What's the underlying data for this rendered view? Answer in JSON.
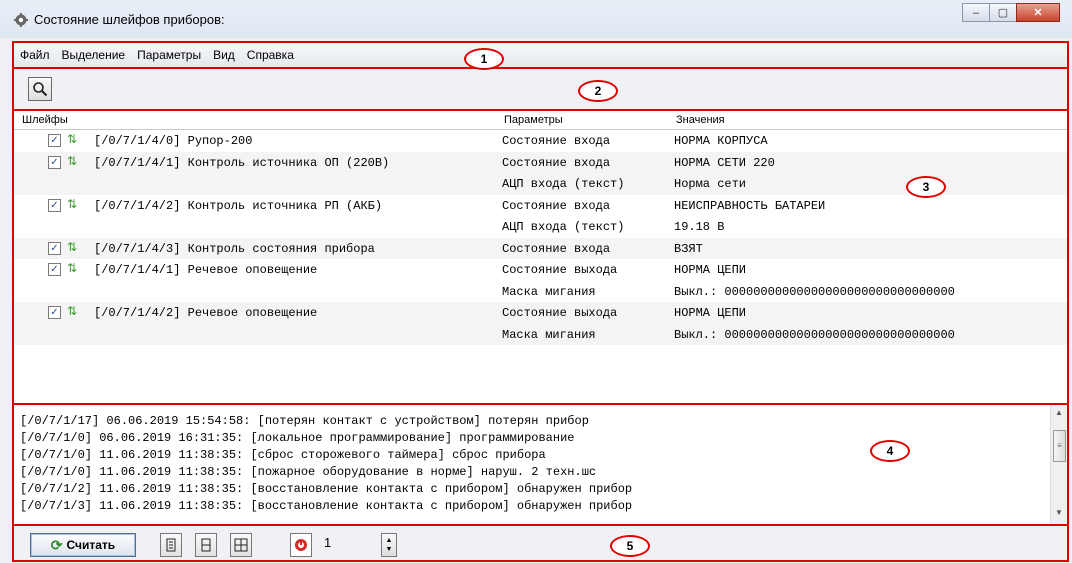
{
  "window": {
    "title": "Состояние шлейфов приборов:",
    "minimize": "–",
    "maximize": "▢",
    "close": "✕"
  },
  "menu": [
    "Файл",
    "Выделение",
    "Параметры",
    "Вид",
    "Справка"
  ],
  "toolbar": {
    "search_icon": "search-icon"
  },
  "table": {
    "headers": {
      "loops": "Шлейфы",
      "params": "Параметры",
      "values": "Значения"
    },
    "rows": [
      {
        "checked": "✓",
        "name": "[/0/7/1/4/0] Рупор-200",
        "param": "Состояние входа",
        "value": "НОРМА КОРПУСА"
      },
      {
        "checked": "✓",
        "name": "[/0/7/1/4/1] Контроль источника ОП (220В)",
        "param": "Состояние входа",
        "value": "НОРМА СЕТИ 220"
      },
      {
        "checked": "",
        "name": "",
        "param": "АЦП входа (текст)",
        "value": "Норма сети"
      },
      {
        "checked": "✓",
        "name": "[/0/7/1/4/2] Контроль источника РП (АКБ)",
        "param": "Состояние входа",
        "value": "НЕИСПРАВНОСТЬ БАТАРЕИ"
      },
      {
        "checked": "",
        "name": "",
        "param": "АЦП входа (текст)",
        "value": "19.18 В"
      },
      {
        "checked": "✓",
        "name": "[/0/7/1/4/3] Контроль состояния прибора",
        "param": "Состояние входа",
        "value": "ВЗЯТ"
      },
      {
        "checked": "✓",
        "name": "[/0/7/1/4/1] Речевое оповещение",
        "param": "Состояние выхода",
        "value": "НОРМА ЦЕПИ"
      },
      {
        "checked": "",
        "name": "",
        "param": "Маска мигания",
        "value": "Выкл.: 00000000000000000000000000000000"
      },
      {
        "checked": "✓",
        "name": "[/0/7/1/4/2] Речевое оповещение",
        "param": "Состояние выхода",
        "value": "НОРМА ЦЕПИ"
      },
      {
        "checked": "",
        "name": "",
        "param": "Маска мигания",
        "value": "Выкл.: 00000000000000000000000000000000"
      }
    ]
  },
  "log": [
    "[/0/7/1/17] 06.06.2019 15:54:58: [потерян контакт с устройством] потерян прибор",
    "[/0/7/1/0] 06.06.2019 16:31:35: [локальное программирование] программирование",
    "[/0/7/1/0] 11.06.2019 11:38:35: [сброс сторожевого таймера] сброс прибора",
    "[/0/7/1/0] 11.06.2019 11:38:35: [пожарное оборудование в норме] наруш. 2 техн.шс",
    "[/0/7/1/2] 11.06.2019 11:38:35: [восстановление контакта с прибором] обнаружен прибор",
    "[/0/7/1/3] 11.06.2019 11:38:35: [восстановление контакта с прибором] обнаружен прибор"
  ],
  "statusbar": {
    "read_label": "Считать",
    "counter_value": "1"
  },
  "callouts": [
    "1",
    "2",
    "3",
    "4",
    "5"
  ],
  "colors": {
    "annotation_red": "#e00000",
    "refresh_green": "#2d8a2d"
  }
}
